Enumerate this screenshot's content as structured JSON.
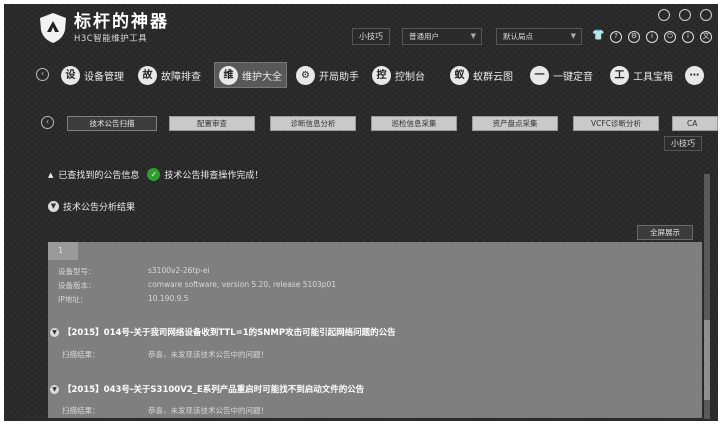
{
  "app": {
    "title": "标杆的神器",
    "subtitle": "H3C智能维护工具"
  },
  "header": {
    "tips_label": "小技巧",
    "user_select": "普通用户",
    "site_select": "默认局点",
    "icons": [
      "shirt-icon",
      "help-icon",
      "settings-icon",
      "info-icon",
      "power-icon",
      "about-icon",
      "language-icon"
    ]
  },
  "window_controls": [
    "minimize-icon",
    "restore-icon",
    "close-icon"
  ],
  "nav": {
    "items": [
      {
        "label": "设备管理",
        "icon": "device-management-icon"
      },
      {
        "label": "故障排查",
        "icon": "troubleshoot-icon"
      },
      {
        "label": "维护大全",
        "icon": "maintenance-icon",
        "active": true
      },
      {
        "label": "开局助手",
        "icon": "setup-assistant-icon"
      },
      {
        "label": "控制台",
        "icon": "console-icon"
      },
      {
        "label": "蚁群云图",
        "icon": "cloud-map-icon"
      },
      {
        "label": "一键定音",
        "icon": "one-click-icon"
      },
      {
        "label": "工具宝箱",
        "icon": "toolbox-icon"
      }
    ]
  },
  "subtabs": {
    "items": [
      {
        "label": "技术公告扫描",
        "active": true
      },
      {
        "label": "配置审查"
      },
      {
        "label": "诊断信息分析"
      },
      {
        "label": "巡检信息采集"
      },
      {
        "label": "资产盘点采集"
      },
      {
        "label": "VCFC诊断分析"
      },
      {
        "label": "CA"
      }
    ]
  },
  "tooltip": "小技巧",
  "content": {
    "found_label": "已查找到的公告信息",
    "status_text": "技术公告排查操作完成！",
    "analysis_label": "技术公告分析结果",
    "fullscreen_label": "全屏展示",
    "panel": {
      "tab": "1",
      "device": [
        {
          "label": "设备型号：",
          "value": "s3100v2-26tp-ei"
        },
        {
          "label": "设备版本：",
          "value": "comware software, version 5.20, release 5103p01"
        },
        {
          "label": "IP地址：",
          "value": "10.190.9.5"
        }
      ],
      "notices": [
        {
          "title": "【2015】014号-关于我司网络设备收到TTL=1的SNMP攻击可能引起网络问题的公告",
          "scan_label": "扫描结果：",
          "scan_value": "恭喜，未发现该技术公告中的问题！"
        },
        {
          "title": "【2015】043号-关于S3100V2_E系列产品重启时可能找不到启动文件的公告",
          "scan_label": "扫描结果：",
          "scan_value": "恭喜，未发现该技术公告中的问题！"
        }
      ]
    }
  }
}
